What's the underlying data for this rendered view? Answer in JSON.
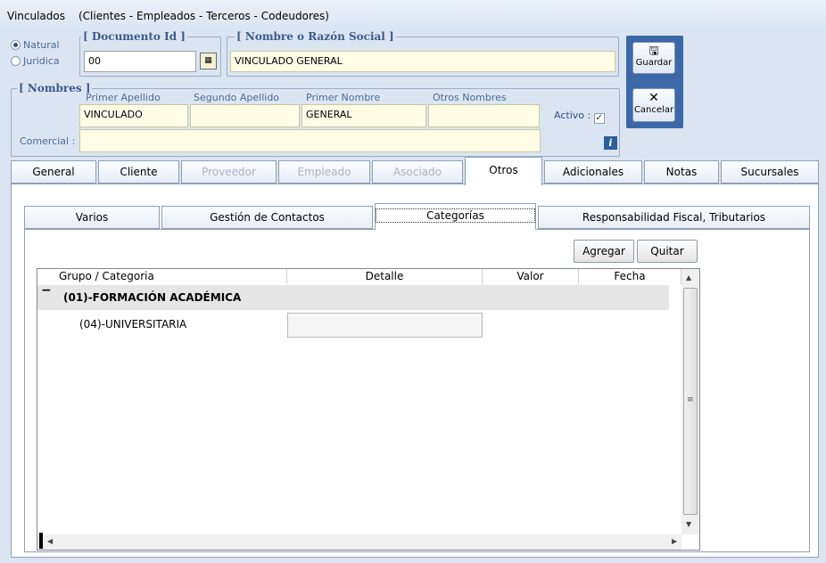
{
  "title": {
    "app": "Vinculados",
    "subtitle": "(Clientes - Empleados - Terceros - Codeudores)"
  },
  "persona": {
    "natural": "Natural",
    "juridica": "Juridica"
  },
  "documento": {
    "legend": "[ Documento Id ]",
    "value": "00"
  },
  "nombre": {
    "legend": "[ Nombre o Razón Social ]",
    "value": "VINCULADO GENERAL"
  },
  "nombres": {
    "legend": "[ Nombres ]",
    "primer_apellido_label": "Primer Apellido",
    "primer_apellido": "VINCULADO",
    "segundo_apellido_label": "Segundo Apellido",
    "segundo_apellido": "",
    "primer_nombre_label": "Primer Nombre",
    "primer_nombre": "GENERAL",
    "otros_nombres_label": "Otros Nombres",
    "otros_nombres": "",
    "activo_label": "Activo :",
    "comercial_label": "Comercial :",
    "comercial": ""
  },
  "actions": {
    "guardar": "Guardar",
    "cancelar": "Cancelar",
    "info": "i"
  },
  "tabs": [
    "General",
    "Cliente",
    "Proveedor",
    "Empleado",
    "Asociado",
    "Otros",
    "Adicionales",
    "Notas",
    "Sucursales"
  ],
  "subtabs": [
    "Varios",
    "Gestión de Contactos",
    "Categorías",
    "Responsabilidad Fiscal, Tributarios"
  ],
  "buttons": {
    "agregar": "Agregar",
    "quitar": "Quitar"
  },
  "grid": {
    "columns": [
      "Grupo / Categoria",
      "Detalle",
      "Valor",
      "Fecha"
    ],
    "group": "(01)-FORMACIÓN ACADÉMICA",
    "rows": [
      {
        "categoria": "(04)-UNIVERSITARIA",
        "detalle": ""
      }
    ],
    "collapse": "−"
  }
}
